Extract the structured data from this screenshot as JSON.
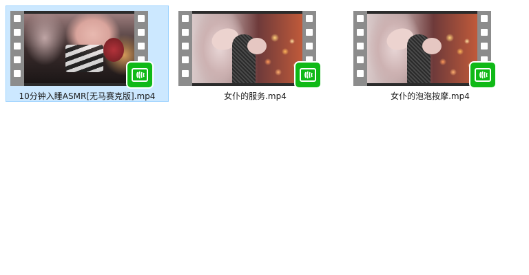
{
  "files": [
    {
      "name": "10分钟入睡ASMR[无马赛克版].mp4",
      "selected": true,
      "icon": "video-player-badge-icon"
    },
    {
      "name": "女仆的服务.mp4",
      "selected": false,
      "icon": "video-player-badge-icon"
    },
    {
      "name": "女仆的泡泡按摩.mp4",
      "selected": false,
      "icon": "video-player-badge-icon"
    }
  ],
  "colors": {
    "selection_bg": "#cce8ff",
    "selection_border": "#99d1ff",
    "badge_green": "#10b917",
    "filmstrip": "#8c8c8c"
  }
}
